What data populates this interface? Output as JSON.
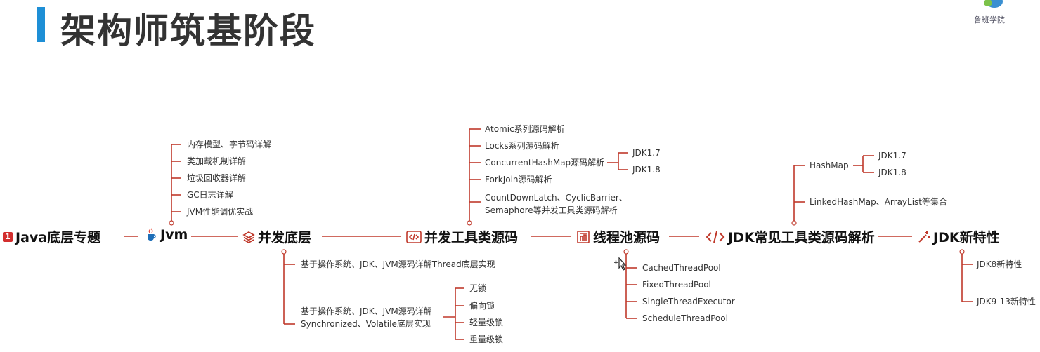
{
  "header": {
    "title": "架构师筑基阶段",
    "logo_text": "鲁班学院"
  },
  "main_nodes": [
    {
      "label": "Java底层专题",
      "icon": "number-one-badge-icon"
    },
    {
      "label": "Jvm",
      "icon": "java-cup-icon"
    },
    {
      "label": "并发底层",
      "icon": "layers-icon"
    },
    {
      "label": "并发工具类源码",
      "icon": "code-box-icon"
    },
    {
      "label": "线程池源码",
      "icon": "document-icon"
    },
    {
      "label": "JDK常见工具类源码解析",
      "icon": "code-tag-icon"
    },
    {
      "label": "JDK新特性",
      "icon": "magic-wand-icon"
    }
  ],
  "jvm_topics": [
    "内存模型、字节码详解",
    "类加载机制详解",
    "垃圾回收器详解",
    "GC日志详解",
    "JVM性能调优实战"
  ],
  "concurrency_base": {
    "item1": "基于操作系统、JDK、JVM源码详解Thread底层实现",
    "item2_line1": "基于操作系统、JDK、JVM源码详解",
    "item2_line2": "Synchronized、Volatile底层实现",
    "locks": [
      "无锁",
      "偏向锁",
      "轻量级锁",
      "重量级锁"
    ]
  },
  "concurrency_tools": {
    "items": [
      "Atomic系列源码解析",
      "Locks系列源码解析",
      "ConcurrentHashMap源码解析",
      "ForkJoin源码解析"
    ],
    "item5_line1": "CountDownLatch、CyclicBarrier、",
    "item5_line2": "Semaphore等并发工具类源码解析",
    "chm_versions": [
      "JDK1.7",
      "JDK1.8"
    ]
  },
  "thread_pool": [
    "CachedThreadPool",
    "FixedThreadPool",
    "SingleThreadExecutor",
    "ScheduleThreadPool"
  ],
  "jdk_utils": {
    "hashmap": "HashMap",
    "hashmap_versions": [
      "JDK1.7",
      "JDK1.8"
    ],
    "collections": "LinkedHashMap、ArrayList等集合"
  },
  "jdk_features": [
    "JDK8新特性",
    "JDK9-13新特性"
  ],
  "colors": {
    "line": "#c0392b",
    "accent_bar": "#1e8fd6",
    "badge": "#d32f2f"
  }
}
